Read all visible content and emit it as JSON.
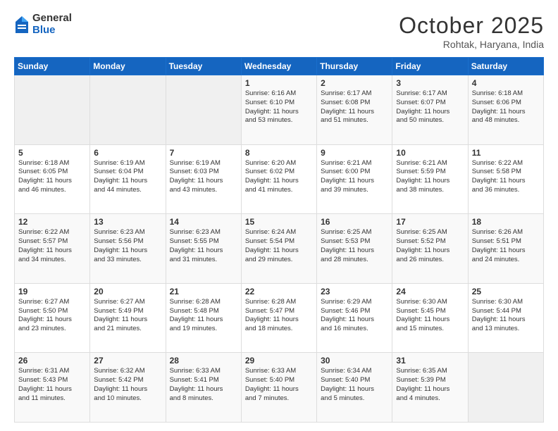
{
  "header": {
    "logo_general": "General",
    "logo_blue": "Blue",
    "month_title": "October 2025",
    "location": "Rohtak, Haryana, India"
  },
  "days_of_week": [
    "Sunday",
    "Monday",
    "Tuesday",
    "Wednesday",
    "Thursday",
    "Friday",
    "Saturday"
  ],
  "weeks": [
    [
      {
        "day": "",
        "content": ""
      },
      {
        "day": "",
        "content": ""
      },
      {
        "day": "",
        "content": ""
      },
      {
        "day": "1",
        "content": "Sunrise: 6:16 AM\nSunset: 6:10 PM\nDaylight: 11 hours\nand 53 minutes."
      },
      {
        "day": "2",
        "content": "Sunrise: 6:17 AM\nSunset: 6:08 PM\nDaylight: 11 hours\nand 51 minutes."
      },
      {
        "day": "3",
        "content": "Sunrise: 6:17 AM\nSunset: 6:07 PM\nDaylight: 11 hours\nand 50 minutes."
      },
      {
        "day": "4",
        "content": "Sunrise: 6:18 AM\nSunset: 6:06 PM\nDaylight: 11 hours\nand 48 minutes."
      }
    ],
    [
      {
        "day": "5",
        "content": "Sunrise: 6:18 AM\nSunset: 6:05 PM\nDaylight: 11 hours\nand 46 minutes."
      },
      {
        "day": "6",
        "content": "Sunrise: 6:19 AM\nSunset: 6:04 PM\nDaylight: 11 hours\nand 44 minutes."
      },
      {
        "day": "7",
        "content": "Sunrise: 6:19 AM\nSunset: 6:03 PM\nDaylight: 11 hours\nand 43 minutes."
      },
      {
        "day": "8",
        "content": "Sunrise: 6:20 AM\nSunset: 6:02 PM\nDaylight: 11 hours\nand 41 minutes."
      },
      {
        "day": "9",
        "content": "Sunrise: 6:21 AM\nSunset: 6:00 PM\nDaylight: 11 hours\nand 39 minutes."
      },
      {
        "day": "10",
        "content": "Sunrise: 6:21 AM\nSunset: 5:59 PM\nDaylight: 11 hours\nand 38 minutes."
      },
      {
        "day": "11",
        "content": "Sunrise: 6:22 AM\nSunset: 5:58 PM\nDaylight: 11 hours\nand 36 minutes."
      }
    ],
    [
      {
        "day": "12",
        "content": "Sunrise: 6:22 AM\nSunset: 5:57 PM\nDaylight: 11 hours\nand 34 minutes."
      },
      {
        "day": "13",
        "content": "Sunrise: 6:23 AM\nSunset: 5:56 PM\nDaylight: 11 hours\nand 33 minutes."
      },
      {
        "day": "14",
        "content": "Sunrise: 6:23 AM\nSunset: 5:55 PM\nDaylight: 11 hours\nand 31 minutes."
      },
      {
        "day": "15",
        "content": "Sunrise: 6:24 AM\nSunset: 5:54 PM\nDaylight: 11 hours\nand 29 minutes."
      },
      {
        "day": "16",
        "content": "Sunrise: 6:25 AM\nSunset: 5:53 PM\nDaylight: 11 hours\nand 28 minutes."
      },
      {
        "day": "17",
        "content": "Sunrise: 6:25 AM\nSunset: 5:52 PM\nDaylight: 11 hours\nand 26 minutes."
      },
      {
        "day": "18",
        "content": "Sunrise: 6:26 AM\nSunset: 5:51 PM\nDaylight: 11 hours\nand 24 minutes."
      }
    ],
    [
      {
        "day": "19",
        "content": "Sunrise: 6:27 AM\nSunset: 5:50 PM\nDaylight: 11 hours\nand 23 minutes."
      },
      {
        "day": "20",
        "content": "Sunrise: 6:27 AM\nSunset: 5:49 PM\nDaylight: 11 hours\nand 21 minutes."
      },
      {
        "day": "21",
        "content": "Sunrise: 6:28 AM\nSunset: 5:48 PM\nDaylight: 11 hours\nand 19 minutes."
      },
      {
        "day": "22",
        "content": "Sunrise: 6:28 AM\nSunset: 5:47 PM\nDaylight: 11 hours\nand 18 minutes."
      },
      {
        "day": "23",
        "content": "Sunrise: 6:29 AM\nSunset: 5:46 PM\nDaylight: 11 hours\nand 16 minutes."
      },
      {
        "day": "24",
        "content": "Sunrise: 6:30 AM\nSunset: 5:45 PM\nDaylight: 11 hours\nand 15 minutes."
      },
      {
        "day": "25",
        "content": "Sunrise: 6:30 AM\nSunset: 5:44 PM\nDaylight: 11 hours\nand 13 minutes."
      }
    ],
    [
      {
        "day": "26",
        "content": "Sunrise: 6:31 AM\nSunset: 5:43 PM\nDaylight: 11 hours\nand 11 minutes."
      },
      {
        "day": "27",
        "content": "Sunrise: 6:32 AM\nSunset: 5:42 PM\nDaylight: 11 hours\nand 10 minutes."
      },
      {
        "day": "28",
        "content": "Sunrise: 6:33 AM\nSunset: 5:41 PM\nDaylight: 11 hours\nand 8 minutes."
      },
      {
        "day": "29",
        "content": "Sunrise: 6:33 AM\nSunset: 5:40 PM\nDaylight: 11 hours\nand 7 minutes."
      },
      {
        "day": "30",
        "content": "Sunrise: 6:34 AM\nSunset: 5:40 PM\nDaylight: 11 hours\nand 5 minutes."
      },
      {
        "day": "31",
        "content": "Sunrise: 6:35 AM\nSunset: 5:39 PM\nDaylight: 11 hours\nand 4 minutes."
      },
      {
        "day": "",
        "content": ""
      }
    ]
  ]
}
